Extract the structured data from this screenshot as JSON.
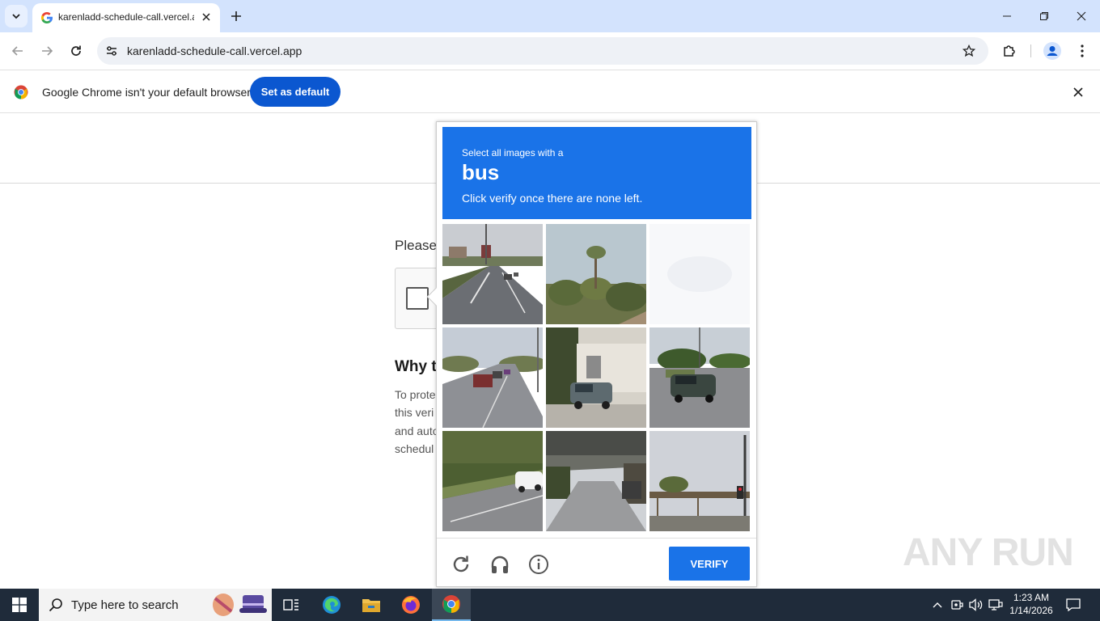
{
  "browser": {
    "tab_title": "karenladd-schedule-call.vercel.app",
    "url": "karenladd-schedule-call.vercel.app"
  },
  "infobar": {
    "message": "Google Chrome isn't your default browser",
    "button_label": "Set as default"
  },
  "page": {
    "please_text": "Please",
    "why_heading": "Why t",
    "why_lines": [
      "To prote",
      "this veri",
      "and auto",
      "schedul"
    ]
  },
  "captcha": {
    "instruction_line1": "Select all images with a",
    "target_word": "bus",
    "instruction_line3": "Click verify once there are none left.",
    "verify_label": "VERIFY",
    "tiles": [
      {
        "scene": "road-with-cars",
        "selected": false
      },
      {
        "scene": "shrubs-sky",
        "selected": false
      },
      {
        "scene": "fading-blank",
        "selected": false
      },
      {
        "scene": "road-with-cars",
        "selected": false
      },
      {
        "scene": "parked-car-building",
        "selected": false
      },
      {
        "scene": "car-on-road",
        "selected": false
      },
      {
        "scene": "roadside-car",
        "selected": false
      },
      {
        "scene": "overpass-road",
        "selected": false
      },
      {
        "scene": "bridge-traffic-light",
        "selected": false
      }
    ]
  },
  "watermark": "ANY RUN",
  "taskbar": {
    "search_placeholder": "Type here to search",
    "time": "1:23 AM",
    "date": "1/14/2026"
  },
  "colors": {
    "accent": "#1a73e8",
    "chrome_button": "#0b57d0",
    "tabstrip": "#d3e3fd",
    "taskbar": "#1f2b3a"
  }
}
